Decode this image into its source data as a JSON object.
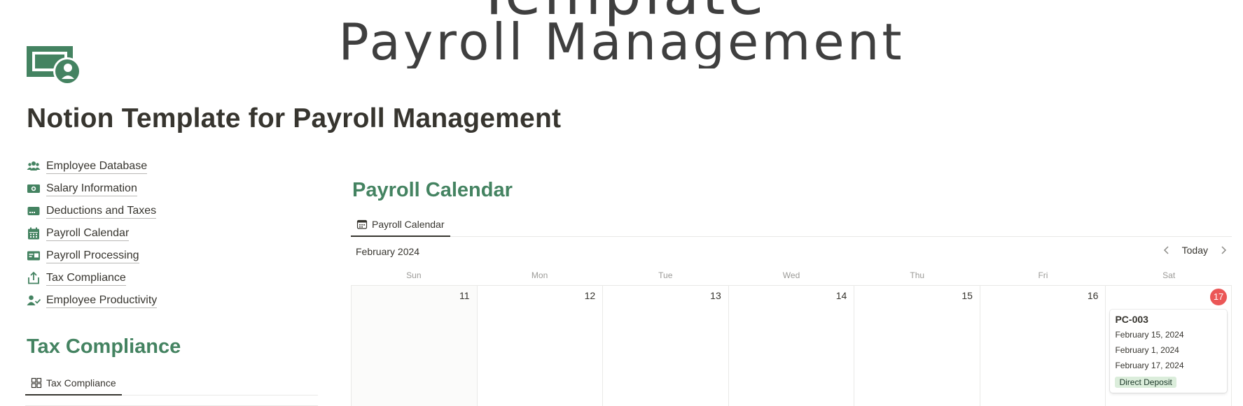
{
  "cover": {
    "line1": "Template",
    "line2": "Payroll Management"
  },
  "page": {
    "icon": "money-bill-icon",
    "title": "Notion Template for Payroll Management"
  },
  "nav": {
    "items": [
      {
        "label": "Employee Database",
        "icon": "users-icon"
      },
      {
        "label": "Salary Information",
        "icon": "money-bill-icon"
      },
      {
        "label": "Deductions and Taxes",
        "icon": "card-icon"
      },
      {
        "label": "Payroll Calendar",
        "icon": "calendar-icon"
      },
      {
        "label": "Payroll Processing",
        "icon": "id-card-icon"
      },
      {
        "label": "Tax Compliance",
        "icon": "share-upload-icon"
      },
      {
        "label": "Employee Productivity",
        "icon": "user-check-icon"
      }
    ]
  },
  "tax_section": {
    "heading": "Tax Compliance",
    "tab_label": "Tax Compliance"
  },
  "calendar_section": {
    "heading": "Payroll Calendar",
    "tab_label": "Payroll Calendar",
    "month": "February 2024",
    "today_label": "Today",
    "weekdays": [
      "Sun",
      "Mon",
      "Tue",
      "Wed",
      "Thu",
      "Fri",
      "Sat"
    ],
    "days": [
      "11",
      "12",
      "13",
      "14",
      "15",
      "16",
      "17"
    ],
    "event": {
      "title": "PC-003",
      "dates": [
        "February 15, 2024",
        "February 1, 2024",
        "February 17, 2024"
      ],
      "tag": "Direct Deposit"
    }
  },
  "colors": {
    "accent_green": "#448361",
    "today_red": "#eb5757",
    "tag_green_bg": "#dbeddb",
    "icon_green": "#448361"
  }
}
